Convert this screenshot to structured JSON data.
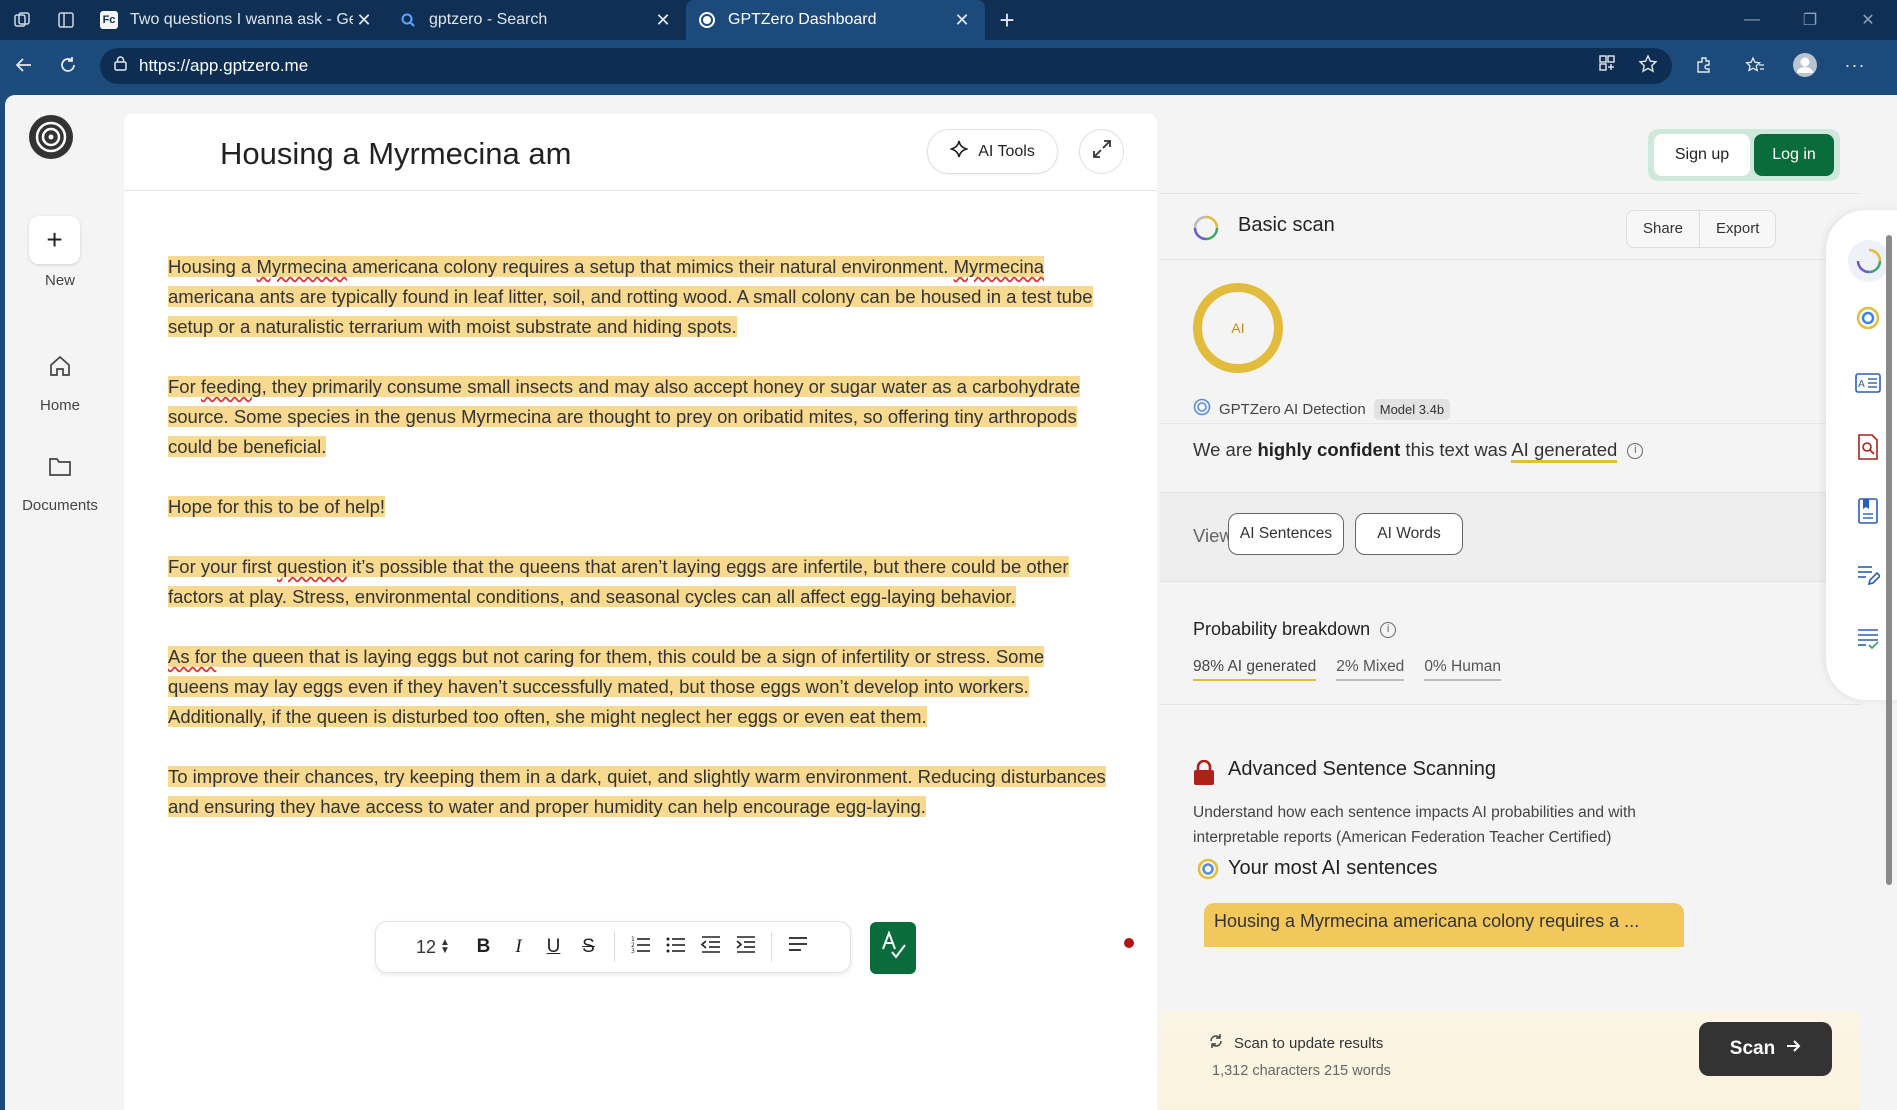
{
  "browser": {
    "tabs": [
      {
        "title": "Two questions I wanna ask - Gene",
        "active": false
      },
      {
        "title": "gptzero - Search",
        "active": false
      },
      {
        "title": "GPTZero Dashboard",
        "active": true
      }
    ],
    "url": "https://app.gptzero.me"
  },
  "leftnav": {
    "new_label": "New",
    "home_label": "Home",
    "documents_label": "Documents"
  },
  "editor": {
    "title": "Housing a Myrmecina am",
    "ai_tools_label": "AI Tools",
    "font_size": "12",
    "paragraphs": [
      "Housing a Myrmecina americana colony requires a setup that mimics their natural environment. Myrmecina americana ants are typically found in leaf litter, soil, and rotting wood. A small colony can be housed in a test tube setup or a naturalistic terrarium with moist substrate and hiding spots.",
      "For feeding, they primarily consume small insects and may also accept honey or sugar water as a carbohydrate source. Some species in the genus Myrmecina are thought to prey on oribatid mites, so offering tiny arthropods could be beneficial.",
      "Hope for this to be of help!",
      "For your first question it’s possible that the queens that aren’t laying eggs are infertile, but there could be other factors at play. Stress, environmental conditions, and seasonal cycles can all affect egg-laying behavior.",
      "As for the queen that is laying eggs but not caring for them, this could be a sign of infertility or stress. Some queens may lay eggs even if they haven’t successfully mated, but those eggs won’t develop into workers. Additionally, if the queen is disturbed too often, she might neglect her eggs or even eat them.",
      "To improve their chances, try keeping them in a dark, quiet, and slightly warm environment. Reducing disturbances and ensuring they have access to water and proper humidity can help encourage egg-laying."
    ]
  },
  "panel": {
    "signup_label": "Sign up",
    "login_label": "Log in",
    "scan_title": "Basic scan",
    "share_label": "Share",
    "export_label": "Export",
    "ring_label": "AI",
    "detector_name": "GPTZero AI Detection",
    "model_badge": "Model 3.4b",
    "confidence": {
      "prefix": "We are ",
      "level": "highly confident",
      "middle": " this text was ",
      "verdict": "AI generated"
    },
    "view_label": "View",
    "view_options": [
      "AI Sentences",
      "AI Words"
    ],
    "prob_title": "Probability breakdown",
    "prob": {
      "ai": "98% AI generated",
      "mixed": "2% Mixed",
      "human": "0% Human"
    },
    "adv_title": "Advanced Sentence Scanning",
    "adv_desc": "Understand how each sentence impacts AI probabilities and with interpretable reports (American Federation Teacher Certified)",
    "most_title": "Your most AI sentences",
    "top_sentence": "Housing a Myrmecina americana colony requires a ...",
    "scan_update": "Scan to update results",
    "counts": "1,312 characters 215 words",
    "scan_label": "Scan"
  },
  "colors": {
    "highlight": "#f7d98f",
    "brand_green": "#0a6b3b",
    "ai_yellow": "#e2bc3c",
    "browser_dark": "#0f3054",
    "browser_mid": "#1c4a7a"
  }
}
